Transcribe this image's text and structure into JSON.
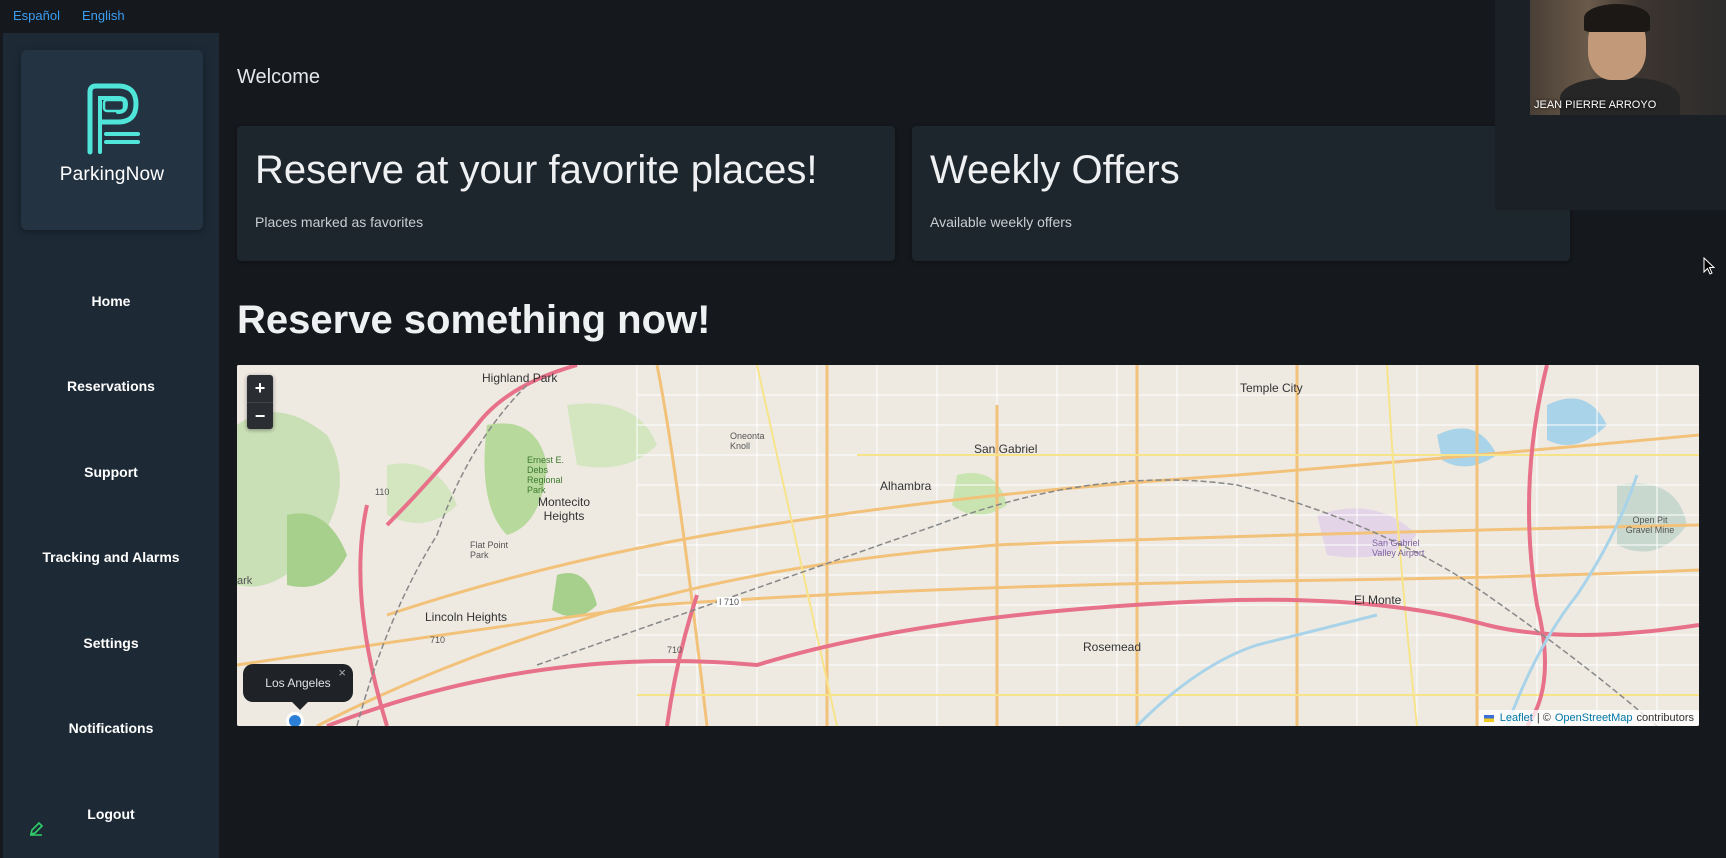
{
  "languages": [
    "Español",
    "English"
  ],
  "brand": {
    "name": "ParkingNow",
    "accent": "#4fe6d9"
  },
  "nav": [
    "Home",
    "Reservations",
    "Support",
    "Tracking and Alarms",
    "Settings",
    "Notifications",
    "Logout"
  ],
  "main": {
    "welcome": "Welcome",
    "cards": [
      {
        "title": "Reserve at your favorite places!",
        "subtitle": "Places marked as favorites"
      },
      {
        "title": "Weekly Offers",
        "subtitle": "Available weekly offers"
      }
    ],
    "section_title": "Reserve something now!"
  },
  "map": {
    "zoom_in": "+",
    "zoom_out": "−",
    "labels": [
      "Highland Park",
      "Temple City",
      "San Gabriel",
      "Alhambra",
      "Montecito Heights",
      "Lincoln Heights",
      "El Monte",
      "Rosemead",
      "Oneonta Knoll",
      "Flat Point Park",
      "Ernest E. Debs Regional Park",
      "Open Pit Gravel Mine",
      "San Gabriel Valley Airport",
      "ark",
      "710",
      "I 710",
      "710",
      "110"
    ],
    "popup": {
      "text": "Los Angeles",
      "close": "×"
    },
    "attribution": {
      "leaflet": "Leaflet",
      "sep": "| ©",
      "osm": "OpenStreetMap",
      "suffix": "contributors"
    }
  },
  "video": {
    "participant": "JEAN PIERRE ARROYO"
  },
  "icons": {
    "edit": "edit-pencil-icon",
    "cursor": "mouse-cursor-icon"
  }
}
